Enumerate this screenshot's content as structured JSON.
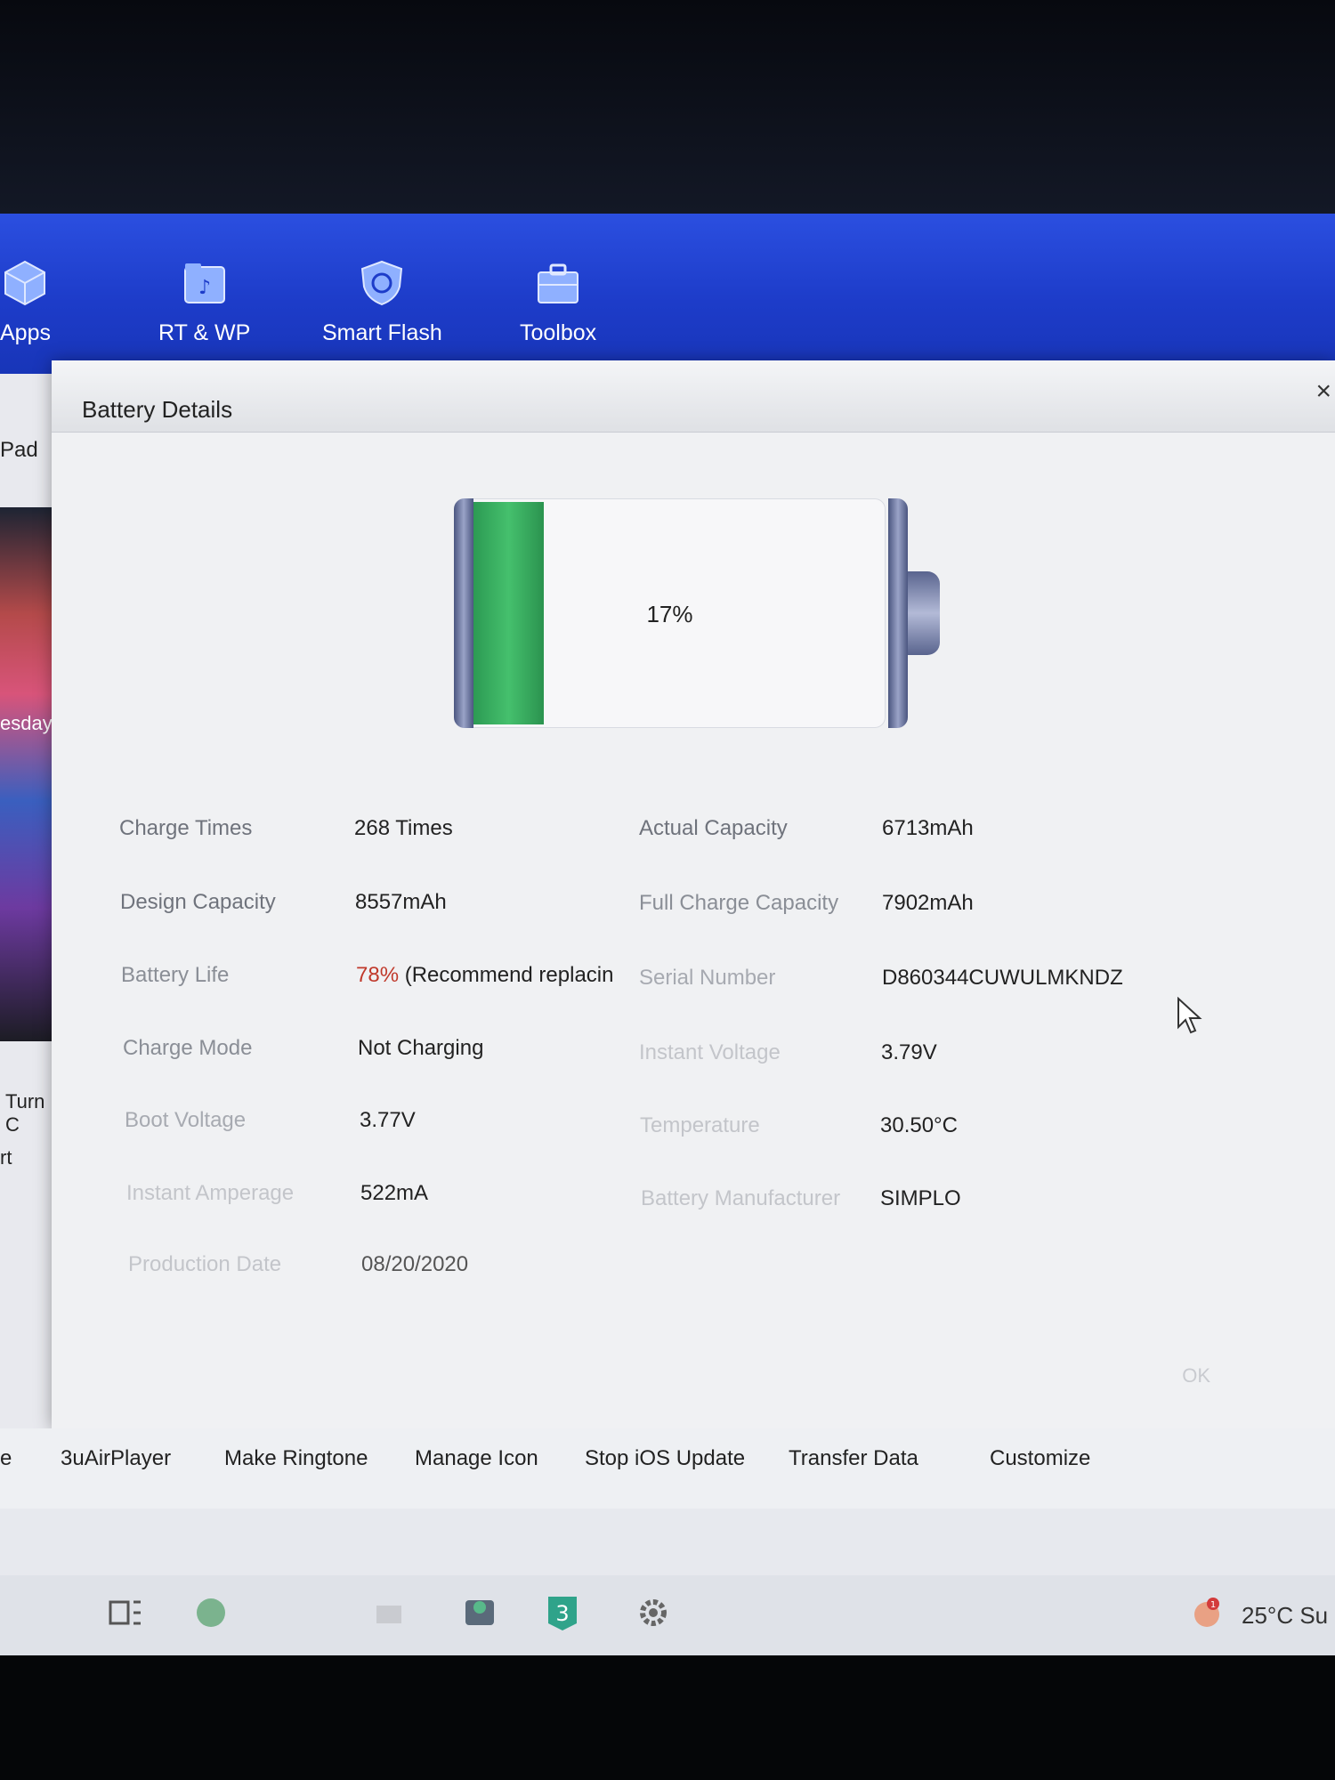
{
  "toolbar": {
    "items": [
      {
        "label": "Apps",
        "icon": "cube-icon"
      },
      {
        "label": "RT & WP",
        "icon": "music-folder-icon"
      },
      {
        "label": "Smart Flash",
        "icon": "shield-refresh-icon"
      },
      {
        "label": "Toolbox",
        "icon": "toolbox-icon"
      }
    ]
  },
  "left_panel": {
    "device_label": "Pad",
    "day_text": "esday,",
    "turn_text": "Turn C",
    "rt_text": "rt"
  },
  "dialog": {
    "title": "Battery Details",
    "close_symbol": "×",
    "battery_percent_text": "17%",
    "battery_level": 0.17,
    "ok_label": "OK",
    "details_left": [
      {
        "label": "Charge Times",
        "value": "268 Times"
      },
      {
        "label": "Design Capacity",
        "value": "8557mAh"
      },
      {
        "label": "Battery Life",
        "value_highlight": "78%",
        "value_rest": " (Recommend replacin"
      },
      {
        "label": "Charge Mode",
        "value": "Not Charging"
      },
      {
        "label": "Boot Voltage",
        "value": "3.77V"
      },
      {
        "label": "Instant Amperage",
        "value": "522mA"
      },
      {
        "label": "Production Date",
        "value": "08/20/2020"
      }
    ],
    "details_right": [
      {
        "label": "Actual Capacity",
        "value": "6713mAh"
      },
      {
        "label": "Full Charge Capacity",
        "value": "7902mAh"
      },
      {
        "label": "Serial Number",
        "value": "D860344CUWULMKNDZ"
      },
      {
        "label": "Instant Voltage",
        "value": "3.79V"
      },
      {
        "label": "Temperature",
        "value": "30.50°C"
      },
      {
        "label": "Battery Manufacturer",
        "value": "SIMPLO"
      }
    ]
  },
  "bottom_tools": [
    "3uAirPlayer",
    "Make Ringtone",
    "Manage Icon",
    "Stop iOS Update",
    "Transfer Data",
    "Customize"
  ],
  "bottom_tools_partial": "e",
  "taskbar": {
    "weather_temp": "25°C",
    "weather_trail": "Su",
    "notification_count": "1"
  },
  "colors": {
    "toolbar_blue": "#1d3cc9",
    "battery_green": "#45c06d",
    "battery_life_red": "#c0392b"
  }
}
